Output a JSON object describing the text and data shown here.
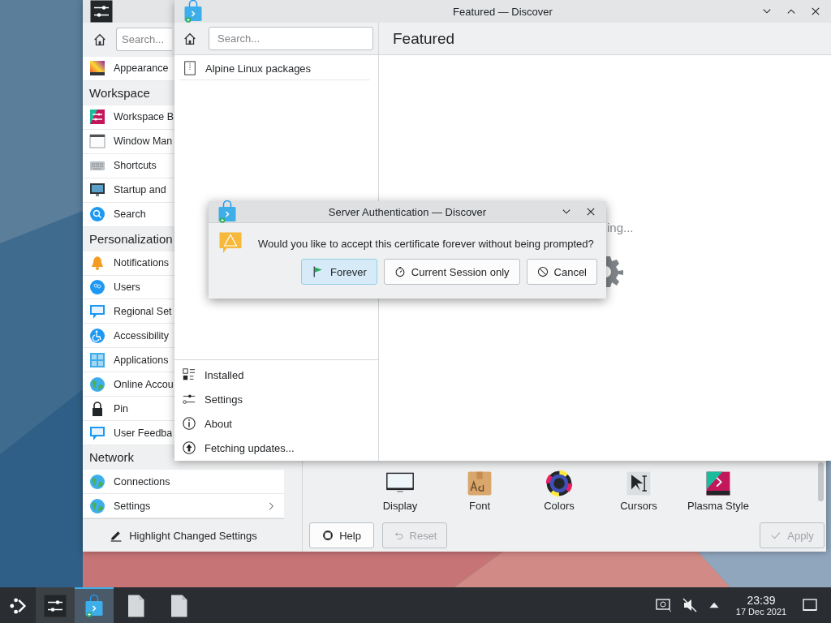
{
  "settings_window": {
    "search": {
      "placeholder": "Search..."
    },
    "sidebar": [
      {
        "kind": "item",
        "label": "Appearance"
      },
      {
        "kind": "header",
        "label": "Workspace"
      },
      {
        "kind": "item",
        "label": "Workspace B"
      },
      {
        "kind": "item",
        "label": "Window Man"
      },
      {
        "kind": "item",
        "label": "Shortcuts"
      },
      {
        "kind": "item",
        "label": "Startup and"
      },
      {
        "kind": "item",
        "label": "Search"
      },
      {
        "kind": "header",
        "label": "Personalization"
      },
      {
        "kind": "item",
        "label": "Notifications"
      },
      {
        "kind": "item",
        "label": "Users"
      },
      {
        "kind": "item",
        "label": "Regional Set"
      },
      {
        "kind": "item",
        "label": "Accessibility"
      },
      {
        "kind": "item",
        "label": "Applications"
      },
      {
        "kind": "item",
        "label": "Online Accou"
      },
      {
        "kind": "item",
        "label": "Pin"
      },
      {
        "kind": "item",
        "label": "User Feedba"
      },
      {
        "kind": "header",
        "label": "Network"
      },
      {
        "kind": "item",
        "label": "Connections"
      },
      {
        "kind": "group",
        "label": "Settings"
      }
    ],
    "highlight_button": "Highlight Changed Settings",
    "grid": [
      {
        "label": "Display"
      },
      {
        "label": "Font"
      },
      {
        "label": "Colors"
      },
      {
        "label": "Cursors"
      },
      {
        "label": "Plasma Style"
      }
    ],
    "buttons": [
      {
        "label": "Help",
        "disabled": false
      },
      {
        "label": "Reset",
        "disabled": true
      },
      {
        "label": "Apply",
        "disabled": true
      }
    ]
  },
  "discover_window": {
    "title": "Featured — Discover",
    "search": {
      "placeholder": "Search..."
    },
    "sources": [
      "Alpine Linux packages"
    ],
    "nav": [
      {
        "label": "Installed"
      },
      {
        "label": "Settings"
      },
      {
        "label": "About"
      },
      {
        "label": "Fetching updates..."
      }
    ],
    "page_title": "Featured",
    "loading_text": "ing..."
  },
  "dialog": {
    "title": "Server Authentication — Discover",
    "message": "Would you like to accept this certificate forever without being prompted?",
    "buttons": [
      {
        "label": "Forever",
        "default": true
      },
      {
        "label": "Current Session only",
        "default": false
      },
      {
        "label": "Cancel",
        "default": false
      }
    ]
  },
  "taskbar": {
    "tasks": [
      {
        "kind": "settings",
        "running": true,
        "active": false
      },
      {
        "kind": "discover",
        "running": true,
        "active": true
      },
      {
        "kind": "file",
        "running": false,
        "active": false
      },
      {
        "kind": "file",
        "running": false,
        "active": false
      }
    ],
    "clock": {
      "time": "23:39",
      "date": "17 Dec 2021"
    }
  }
}
